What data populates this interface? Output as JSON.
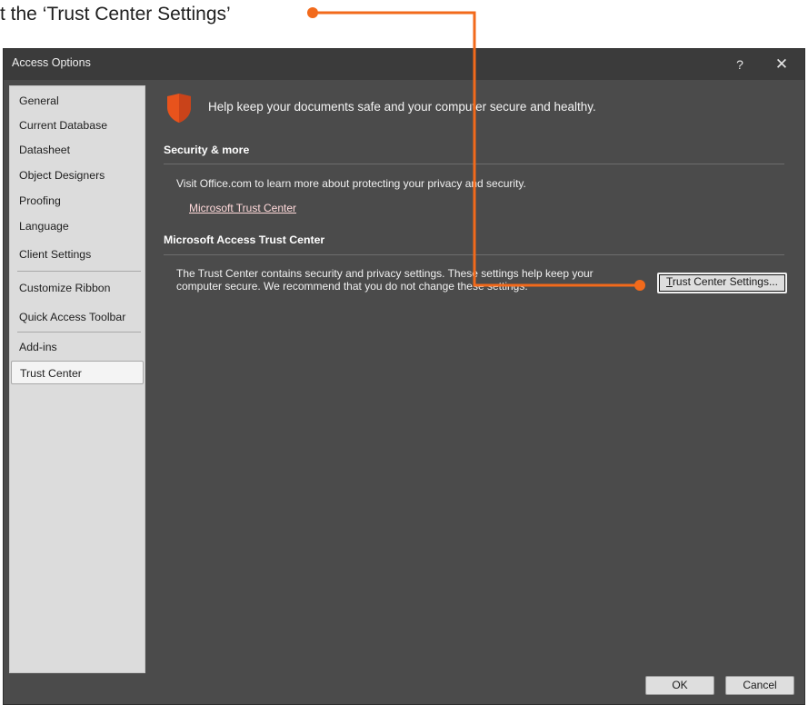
{
  "caption": {
    "text": "t the ‘Trust Center Settings’"
  },
  "window": {
    "title": "Access Options",
    "help_label": "?",
    "close_label": "✕"
  },
  "sidebar": {
    "items": [
      {
        "label": "General"
      },
      {
        "label": "Current Database"
      },
      {
        "label": "Datasheet"
      },
      {
        "label": "Object Designers"
      },
      {
        "label": "Proofing"
      },
      {
        "label": "Language"
      },
      {
        "label": "Client Settings"
      },
      {
        "label": "Customize Ribbon"
      },
      {
        "label": "Quick Access Toolbar"
      },
      {
        "label": "Add-ins"
      },
      {
        "label": "Trust Center",
        "selected": true
      }
    ]
  },
  "main": {
    "hero_text": "Help keep your documents safe and your computer secure and healthy.",
    "security_title": "Security & more",
    "security_text": "Visit Office.com to learn more about protecting your privacy and security.",
    "security_link": "Microsoft Trust Center",
    "trust_title": "Microsoft Access Trust Center",
    "trust_text_1": "The Trust Center contains security and privacy settings. These settings help keep your",
    "trust_text_2": "computer secure. We recommend that you do not change these settings.",
    "trust_button_accel": "T",
    "trust_button_rest": "rust Center Settings..."
  },
  "footer": {
    "ok_label": "OK",
    "cancel_label": "Cancel"
  },
  "colors": {
    "window_bg": "#4b4b4b",
    "titlebar_bg": "#3b3b3b",
    "sidebar_bg": "#dcdcdc",
    "shield_accent": "#e8531c",
    "annotation_orange": "#f26a1b",
    "link_color": "#ffd9da"
  }
}
